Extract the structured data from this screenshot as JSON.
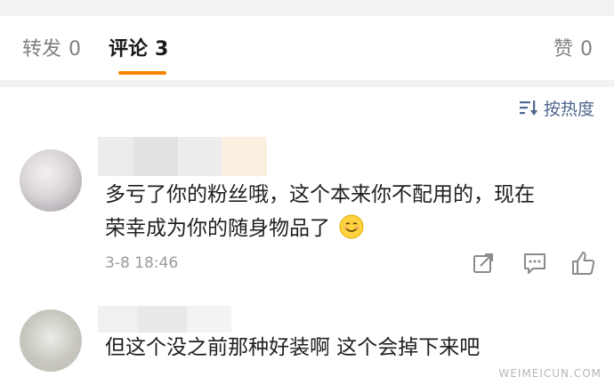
{
  "tabs": {
    "repost": {
      "label": "转发",
      "count": "0"
    },
    "comment": {
      "label": "评论",
      "count": "3"
    },
    "like": {
      "label": "赞",
      "count": "0"
    }
  },
  "sort": {
    "label": "按热度",
    "icon": "sort-icon"
  },
  "comments": [
    {
      "lines": [
        "多亏了你的粉丝哦，这个本来你不配用的，现在",
        "荣幸成为你的随身物品了"
      ],
      "emoji": "smiling-face-emoji",
      "time": "3-8 18:46",
      "actions": [
        "share-icon",
        "reply-icon",
        "thumbs-up-icon"
      ]
    },
    {
      "lines": [
        "但这个没之前那种好装啊 这个会掉下来吧"
      ]
    }
  ],
  "watermark": "WEIMEICUN.COM",
  "colors": {
    "accent": "#ff8200",
    "link": "#50678e",
    "muted": "#9a9a9a"
  }
}
